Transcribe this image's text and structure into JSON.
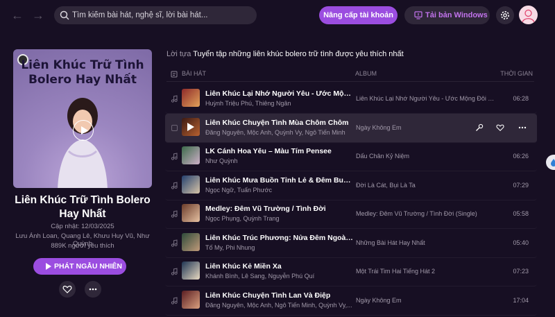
{
  "search": {
    "placeholder": "Tìm kiếm bài hát, nghệ sĩ, lời bài hát..."
  },
  "header": {
    "upgrade_label": "Nâng cấp tài khoản",
    "download_label": "Tải bản Windows"
  },
  "playlist": {
    "cover_title": "Liên Khúc Trữ Tình Bolero Hay Nhất",
    "title": "Liên Khúc Trữ Tình Bolero Hay Nhất",
    "updated": "Cập nhật: 12/03/2025",
    "artists": "Lưu Ánh Loan, Quang Lê, Khưu Huy Vũ, Như Quỳnh",
    "likes": "889K người yêu thích",
    "play_random_label": "PHÁT NGẪU NHIÊN"
  },
  "intro": {
    "prefix": "Lời tựa",
    "text": "Tuyển tập những liên khúc bolero trữ tình được yêu thích nhất"
  },
  "columns": {
    "song": "BÀI HÁT",
    "album": "ALBUM",
    "time": "THỜI GIAN"
  },
  "songs": [
    {
      "title": "Liên Khúc Lại Nhớ Người Yêu - Ước Mộng Đôi...",
      "artists": "Huỳnh Triệu Phú, Thiêng Ngân",
      "album": "Liên Khúc Lại Nhớ Người Yêu - Ước Mộng Đôi Ta...",
      "duration": "06:28"
    },
    {
      "title": "Liên Khúc Chuyện Tình Mùa Chôm Chôm",
      "artists": "Đăng Nguyên, Mộc Anh, Quỳnh Vy, Ngô Tiến Minh",
      "album": "Ngày Không Em",
      "duration": ""
    },
    {
      "title": "LK Cánh Hoa Yêu – Màu Tím Pensee",
      "artists": "Như Quỳnh",
      "album": "Dấu Chân Kỷ Niệm",
      "duration": "06:26"
    },
    {
      "title": "Liên Khúc Mưa Buồn Tỉnh Lẻ & Đêm Buồn...",
      "artists": "Ngọc Ngữ, Tuấn Phước",
      "album": "Đời Là Cát, Bụi Là Ta",
      "duration": "07:29"
    },
    {
      "title": "Medley: Đêm Vũ Trường / Tình Đời",
      "artists": "Ngọc Phụng, Quỳnh Trang",
      "album": "Medley: Đêm Vũ Trường / Tình Đời (Single)",
      "duration": "05:58"
    },
    {
      "title": "Liên Khúc Trúc Phương: Nửa Đêm Ngoài Phố",
      "artists": "Tố My, Phi Nhung",
      "album": "Những Bài Hát Hay Nhất",
      "duration": "05:40"
    },
    {
      "title": "Liên Khúc Kẻ Miền Xa",
      "artists": "Khánh Bình, Lê Sang, Nguyễn Phú Quí",
      "album": "Một Trái Tim Hai Tiếng Hát 2",
      "duration": "07:23"
    },
    {
      "title": "Liên Khúc Chuyện Tình Lan Và Điệp",
      "artists": "Đăng Nguyên, Mộc Anh, Ngô Tiến Minh, Quỳnh Vy,...",
      "album": "Ngày Không Em",
      "duration": "17:04"
    }
  ],
  "colors": {
    "background": "#170f23",
    "accent": "#9b4de0",
    "alpha_bg": "#2f2739",
    "text_secondary": "#a29aaa"
  }
}
